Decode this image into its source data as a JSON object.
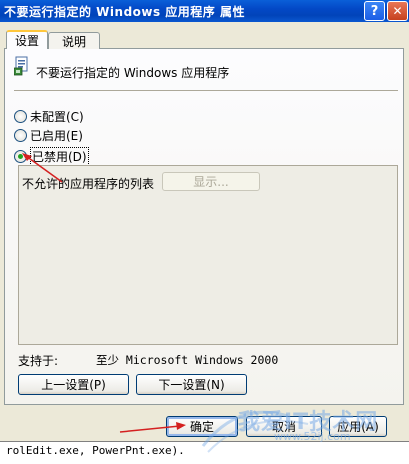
{
  "window": {
    "title": "不要运行指定的 Windows 应用程序 属性",
    "help_label": "?",
    "close_label": "✕"
  },
  "tabs": [
    {
      "label": "设置"
    },
    {
      "label": "说明"
    }
  ],
  "policy": {
    "title": "不要运行指定的 Windows 应用程序"
  },
  "radios": {
    "not_configured": "未配置(C)",
    "enabled": "已启用(E)",
    "disabled": "已禁用(D)",
    "selected": "disabled"
  },
  "options": {
    "list_label": "不允许的应用程序的列表",
    "show_button": "显示..."
  },
  "supported": {
    "label": "支持于:",
    "value": "至少 Microsoft Windows 2000"
  },
  "nav": {
    "prev_label": "上一设置(P)",
    "next_label": "下一设置(N)"
  },
  "footer": {
    "ok_label": "确定",
    "cancel_label": "取消",
    "apply_label": "应用(A)"
  },
  "background_text": "rolEdit.exe, PowerPnt.exe).",
  "watermark": {
    "text": "我爱IT技术网",
    "sub": "www.52ij.com"
  },
  "colors": {
    "titlebar": "#0348c6",
    "dialog_bg": "#ece9d8",
    "annotation_arrow": "#d42020"
  }
}
